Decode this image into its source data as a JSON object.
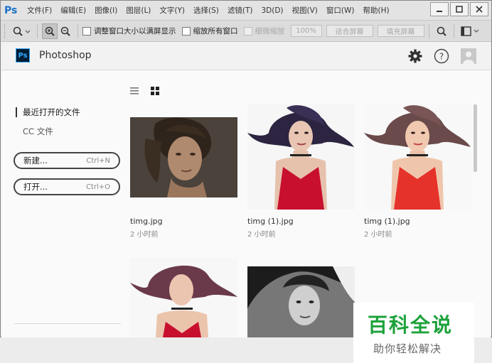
{
  "menubar": {
    "logo": "Ps",
    "items": [
      "文件(F)",
      "编辑(E)",
      "图像(I)",
      "图层(L)",
      "文字(Y)",
      "选择(S)",
      "滤镜(T)",
      "3D(D)",
      "视图(V)",
      "窗口(W)",
      "帮助(H)"
    ]
  },
  "optionsbar": {
    "resize_windows": "调整窗口大小以满屏显示",
    "zoom_all_windows": "缩放所有窗口",
    "scrubby_zoom": "细微缩放",
    "zoom_100": "100%",
    "fit_screen": "适合屏幕",
    "fill_screen": "填充屏幕"
  },
  "header": {
    "badge": "Ps",
    "app_name": "Photoshop"
  },
  "sidebar": {
    "recent_label": "最近打开的文件",
    "cc_label": "CC 文件",
    "new_label": "新建...",
    "new_shortcut": "Ctrl+N",
    "open_label": "打开...",
    "open_shortcut": "Ctrl+O"
  },
  "files": [
    {
      "name": "timg.jpg",
      "time": "2 小时前"
    },
    {
      "name": "timg (1).jpg",
      "time": "2 小时前"
    },
    {
      "name": "timg (1).jpg",
      "time": "2 小时前"
    }
  ],
  "watermark": {
    "title": "百科全说",
    "subtitle": "助你轻松解决"
  },
  "colors": {
    "ps_blue": "#31a8ff",
    "dress_red": "#c8102e",
    "watermark_green": "#1da23b"
  }
}
